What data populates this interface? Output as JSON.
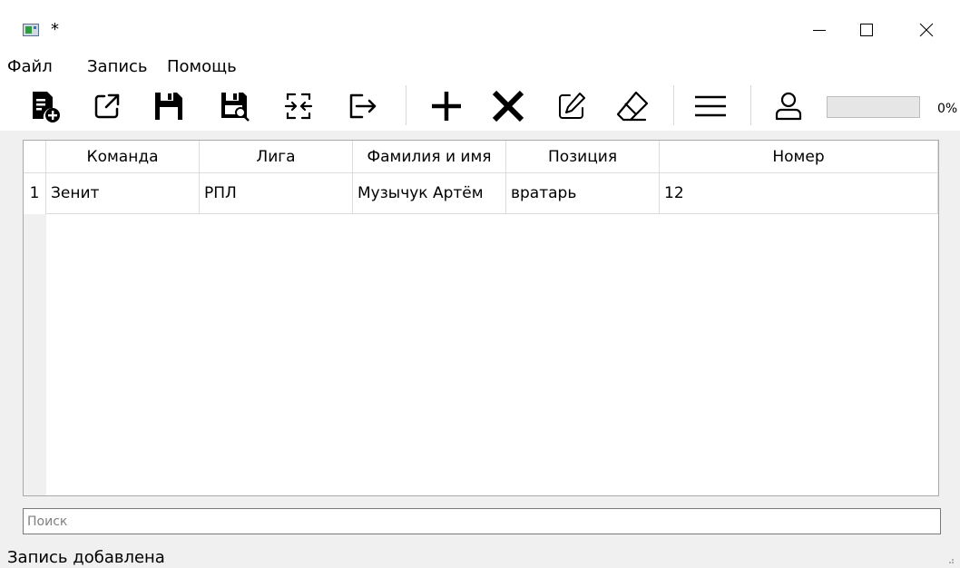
{
  "window": {
    "title": "*"
  },
  "menu": {
    "items": [
      "Файл",
      "Запись",
      "Помощь"
    ]
  },
  "toolbar": {
    "buttons": [
      {
        "name": "new-file-icon"
      },
      {
        "name": "open-external-icon"
      },
      {
        "name": "save-icon"
      },
      {
        "name": "save-as-icon"
      },
      {
        "name": "merge-icon"
      },
      {
        "name": "exit-icon"
      },
      {
        "name": "add-icon"
      },
      {
        "name": "delete-icon"
      },
      {
        "name": "edit-icon"
      },
      {
        "name": "eraser-icon"
      },
      {
        "name": "list-icon"
      },
      {
        "name": "user-icon"
      }
    ],
    "progress": {
      "value": 0,
      "label": "0%"
    }
  },
  "table": {
    "headers": [
      "Команда",
      "Лига",
      "Фамилия и имя",
      "Позиция",
      "Номер"
    ],
    "rows": [
      {
        "num": "1",
        "cells": [
          "Зенит",
          "РПЛ",
          "Музычук Артём",
          "вратарь",
          "12"
        ]
      }
    ]
  },
  "search": {
    "placeholder": "Поиск",
    "value": ""
  },
  "status": {
    "text": "Запись добавлена"
  },
  "colors": {
    "progress_fill": "#06b025",
    "icon": "#000000"
  }
}
